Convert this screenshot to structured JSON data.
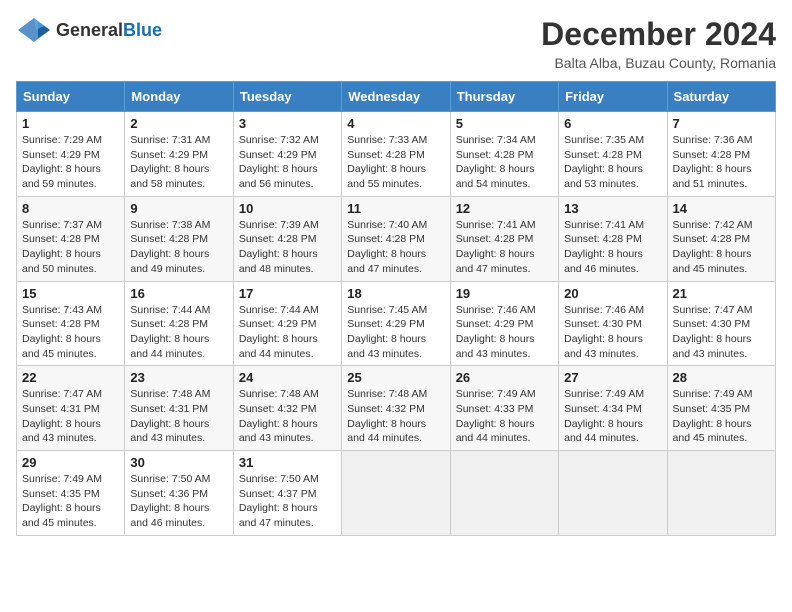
{
  "header": {
    "logo": {
      "general": "General",
      "blue": "Blue"
    },
    "title": "December 2024",
    "subtitle": "Balta Alba, Buzau County, Romania"
  },
  "calendar": {
    "days_of_week": [
      "Sunday",
      "Monday",
      "Tuesday",
      "Wednesday",
      "Thursday",
      "Friday",
      "Saturday"
    ],
    "weeks": [
      [
        null,
        {
          "day": "2",
          "sunrise": "Sunrise: 7:31 AM",
          "sunset": "Sunset: 4:29 PM",
          "daylight": "Daylight: 8 hours and 58 minutes."
        },
        {
          "day": "3",
          "sunrise": "Sunrise: 7:32 AM",
          "sunset": "Sunset: 4:29 PM",
          "daylight": "Daylight: 8 hours and 56 minutes."
        },
        {
          "day": "4",
          "sunrise": "Sunrise: 7:33 AM",
          "sunset": "Sunset: 4:28 PM",
          "daylight": "Daylight: 8 hours and 55 minutes."
        },
        {
          "day": "5",
          "sunrise": "Sunrise: 7:34 AM",
          "sunset": "Sunset: 4:28 PM",
          "daylight": "Daylight: 8 hours and 54 minutes."
        },
        {
          "day": "6",
          "sunrise": "Sunrise: 7:35 AM",
          "sunset": "Sunset: 4:28 PM",
          "daylight": "Daylight: 8 hours and 53 minutes."
        },
        {
          "day": "7",
          "sunrise": "Sunrise: 7:36 AM",
          "sunset": "Sunset: 4:28 PM",
          "daylight": "Daylight: 8 hours and 51 minutes."
        }
      ],
      [
        {
          "day": "1",
          "sunrise": "Sunrise: 7:29 AM",
          "sunset": "Sunset: 4:29 PM",
          "daylight": "Daylight: 8 hours and 59 minutes."
        },
        {
          "day": "9",
          "sunrise": "Sunrise: 7:38 AM",
          "sunset": "Sunset: 4:28 PM",
          "daylight": "Daylight: 8 hours and 49 minutes."
        },
        {
          "day": "10",
          "sunrise": "Sunrise: 7:39 AM",
          "sunset": "Sunset: 4:28 PM",
          "daylight": "Daylight: 8 hours and 48 minutes."
        },
        {
          "day": "11",
          "sunrise": "Sunrise: 7:40 AM",
          "sunset": "Sunset: 4:28 PM",
          "daylight": "Daylight: 8 hours and 47 minutes."
        },
        {
          "day": "12",
          "sunrise": "Sunrise: 7:41 AM",
          "sunset": "Sunset: 4:28 PM",
          "daylight": "Daylight: 8 hours and 47 minutes."
        },
        {
          "day": "13",
          "sunrise": "Sunrise: 7:41 AM",
          "sunset": "Sunset: 4:28 PM",
          "daylight": "Daylight: 8 hours and 46 minutes."
        },
        {
          "day": "14",
          "sunrise": "Sunrise: 7:42 AM",
          "sunset": "Sunset: 4:28 PM",
          "daylight": "Daylight: 8 hours and 45 minutes."
        }
      ],
      [
        {
          "day": "8",
          "sunrise": "Sunrise: 7:37 AM",
          "sunset": "Sunset: 4:28 PM",
          "daylight": "Daylight: 8 hours and 50 minutes."
        },
        {
          "day": "16",
          "sunrise": "Sunrise: 7:44 AM",
          "sunset": "Sunset: 4:28 PM",
          "daylight": "Daylight: 8 hours and 44 minutes."
        },
        {
          "day": "17",
          "sunrise": "Sunrise: 7:44 AM",
          "sunset": "Sunset: 4:29 PM",
          "daylight": "Daylight: 8 hours and 44 minutes."
        },
        {
          "day": "18",
          "sunrise": "Sunrise: 7:45 AM",
          "sunset": "Sunset: 4:29 PM",
          "daylight": "Daylight: 8 hours and 43 minutes."
        },
        {
          "day": "19",
          "sunrise": "Sunrise: 7:46 AM",
          "sunset": "Sunset: 4:29 PM",
          "daylight": "Daylight: 8 hours and 43 minutes."
        },
        {
          "day": "20",
          "sunrise": "Sunrise: 7:46 AM",
          "sunset": "Sunset: 4:30 PM",
          "daylight": "Daylight: 8 hours and 43 minutes."
        },
        {
          "day": "21",
          "sunrise": "Sunrise: 7:47 AM",
          "sunset": "Sunset: 4:30 PM",
          "daylight": "Daylight: 8 hours and 43 minutes."
        }
      ],
      [
        {
          "day": "15",
          "sunrise": "Sunrise: 7:43 AM",
          "sunset": "Sunset: 4:28 PM",
          "daylight": "Daylight: 8 hours and 45 minutes."
        },
        {
          "day": "23",
          "sunrise": "Sunrise: 7:48 AM",
          "sunset": "Sunset: 4:31 PM",
          "daylight": "Daylight: 8 hours and 43 minutes."
        },
        {
          "day": "24",
          "sunrise": "Sunrise: 7:48 AM",
          "sunset": "Sunset: 4:32 PM",
          "daylight": "Daylight: 8 hours and 43 minutes."
        },
        {
          "day": "25",
          "sunrise": "Sunrise: 7:48 AM",
          "sunset": "Sunset: 4:32 PM",
          "daylight": "Daylight: 8 hours and 44 minutes."
        },
        {
          "day": "26",
          "sunrise": "Sunrise: 7:49 AM",
          "sunset": "Sunset: 4:33 PM",
          "daylight": "Daylight: 8 hours and 44 minutes."
        },
        {
          "day": "27",
          "sunrise": "Sunrise: 7:49 AM",
          "sunset": "Sunset: 4:34 PM",
          "daylight": "Daylight: 8 hours and 44 minutes."
        },
        {
          "day": "28",
          "sunrise": "Sunrise: 7:49 AM",
          "sunset": "Sunset: 4:35 PM",
          "daylight": "Daylight: 8 hours and 45 minutes."
        }
      ],
      [
        {
          "day": "22",
          "sunrise": "Sunrise: 7:47 AM",
          "sunset": "Sunset: 4:31 PM",
          "daylight": "Daylight: 8 hours and 43 minutes."
        },
        {
          "day": "30",
          "sunrise": "Sunrise: 7:50 AM",
          "sunset": "Sunset: 4:36 PM",
          "daylight": "Daylight: 8 hours and 46 minutes."
        },
        {
          "day": "31",
          "sunrise": "Sunrise: 7:50 AM",
          "sunset": "Sunset: 4:37 PM",
          "daylight": "Daylight: 8 hours and 47 minutes."
        },
        null,
        null,
        null,
        null
      ],
      [
        {
          "day": "29",
          "sunrise": "Sunrise: 7:49 AM",
          "sunset": "Sunset: 4:35 PM",
          "daylight": "Daylight: 8 hours and 45 minutes."
        }
      ]
    ]
  }
}
